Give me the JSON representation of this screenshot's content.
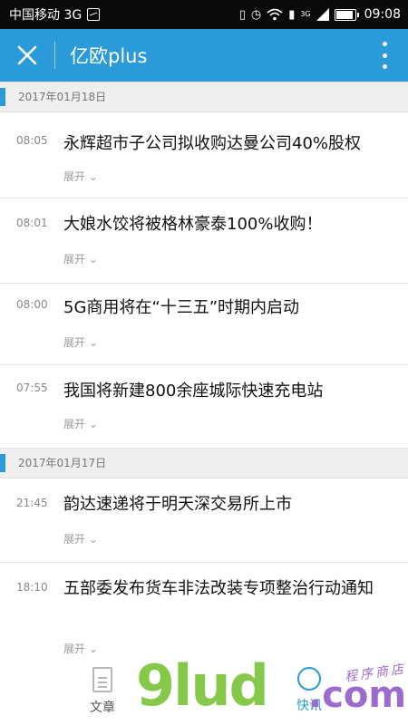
{
  "status_bar": {
    "carrier": "中国移动 3G",
    "network": "3G",
    "time": "09:08",
    "icons": [
      "vibrate-icon",
      "alarm-icon",
      "wifi-icon",
      "sim-icon",
      "signal-icon",
      "battery-icon"
    ],
    "battery_level": 0.85
  },
  "app_bar": {
    "title": "亿欧plus",
    "color": "#2a9ad8"
  },
  "sections": [
    {
      "date": "2017年01月18日",
      "items": [
        {
          "time": "08:05",
          "title": "永辉超市子公司拟收购达曼公司40%股权",
          "expand": "展开"
        },
        {
          "time": "08:01",
          "title": "大娘水饺将被格林豪泰100%收购！",
          "expand": "展开"
        },
        {
          "time": "08:00",
          "title": "5G商用将在“十三五”时期内启动",
          "expand": "展开"
        },
        {
          "time": "07:55",
          "title": "我国将新建800余座城际快速充电站",
          "expand": "展开"
        }
      ]
    },
    {
      "date": "2017年01月17日",
      "items": [
        {
          "time": "21:45",
          "title": "韵达速递将于明天深交易所上市",
          "expand": "展开"
        },
        {
          "time": "18:10",
          "title": "五部委发布货车非法改装专项整治行动通知",
          "expand": "展开"
        }
      ]
    }
  ],
  "bottom_nav": {
    "article": "文章",
    "news": "快讯"
  },
  "watermark": {
    "brand": "9lud",
    "domain": ".com",
    "store": "程序商店"
  }
}
